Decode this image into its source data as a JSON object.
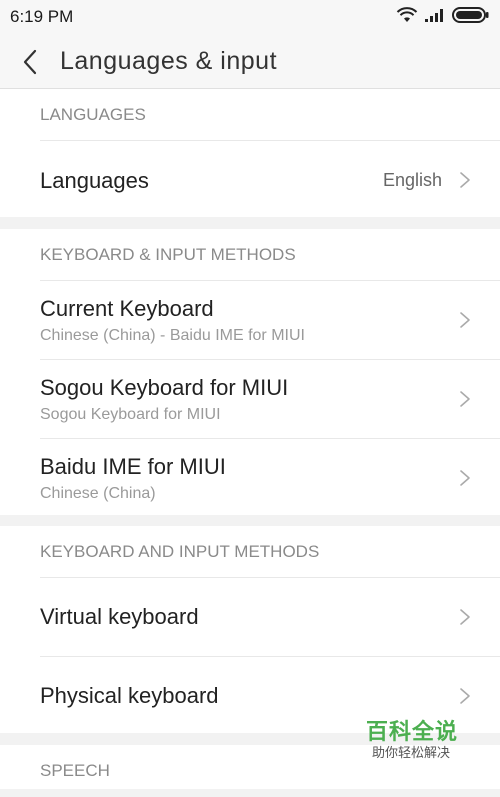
{
  "status_bar": {
    "time": "6:19 PM",
    "icons": [
      "wifi-icon",
      "signal-icon",
      "battery-icon"
    ]
  },
  "title_bar": {
    "title": "Languages & input"
  },
  "sections": {
    "languages": {
      "header": "LANGUAGES",
      "rows": [
        {
          "title": "Languages",
          "value": "English"
        }
      ]
    },
    "keyboard_input": {
      "header": "KEYBOARD & INPUT METHODS",
      "rows": [
        {
          "title": "Current Keyboard",
          "subtitle": "Chinese (China) - Baidu IME for MIUI"
        },
        {
          "title": "Sogou Keyboard for MIUI",
          "subtitle": "Sogou Keyboard for MIUI"
        },
        {
          "title": "Baidu IME for MIUI",
          "subtitle": "Chinese (China)"
        }
      ]
    },
    "keyboard_and_input": {
      "header": "KEYBOARD AND INPUT METHODS",
      "rows": [
        {
          "title": "Virtual keyboard"
        },
        {
          "title": "Physical keyboard"
        }
      ]
    },
    "speech": {
      "header": "SPEECH"
    }
  },
  "watermark": {
    "main": "百科全说",
    "sub": "助你轻松解决"
  },
  "colors": {
    "background": "#f2f2f2",
    "surface": "#ffffff",
    "header_text": "#8a8a8a",
    "primary_text": "#222222",
    "secondary_text": "#9a9a9a",
    "watermark_green": "#4caf50"
  }
}
